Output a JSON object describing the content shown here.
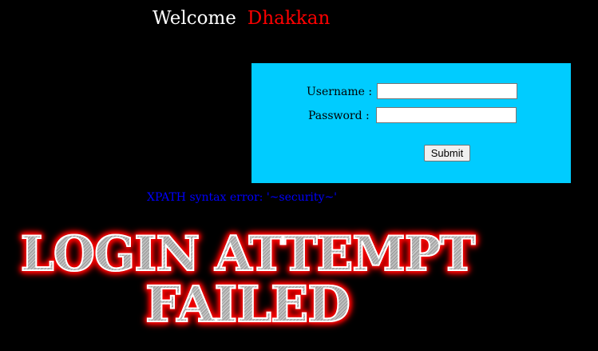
{
  "header": {
    "welcome_label": "Welcome",
    "user_name": "Dhakkan"
  },
  "login_form": {
    "username_label": "Username :",
    "username_value": "",
    "password_label": "Password :",
    "password_value": "",
    "submit_label": "Submit",
    "background_color": "#00ccff"
  },
  "error": {
    "message": "XPATH syntax error: '~security~'",
    "color": "#0000ff"
  },
  "banner": {
    "line1": "LOGIN ATTEMPT",
    "line2": "FAILED",
    "glow_color": "#ff0000"
  }
}
